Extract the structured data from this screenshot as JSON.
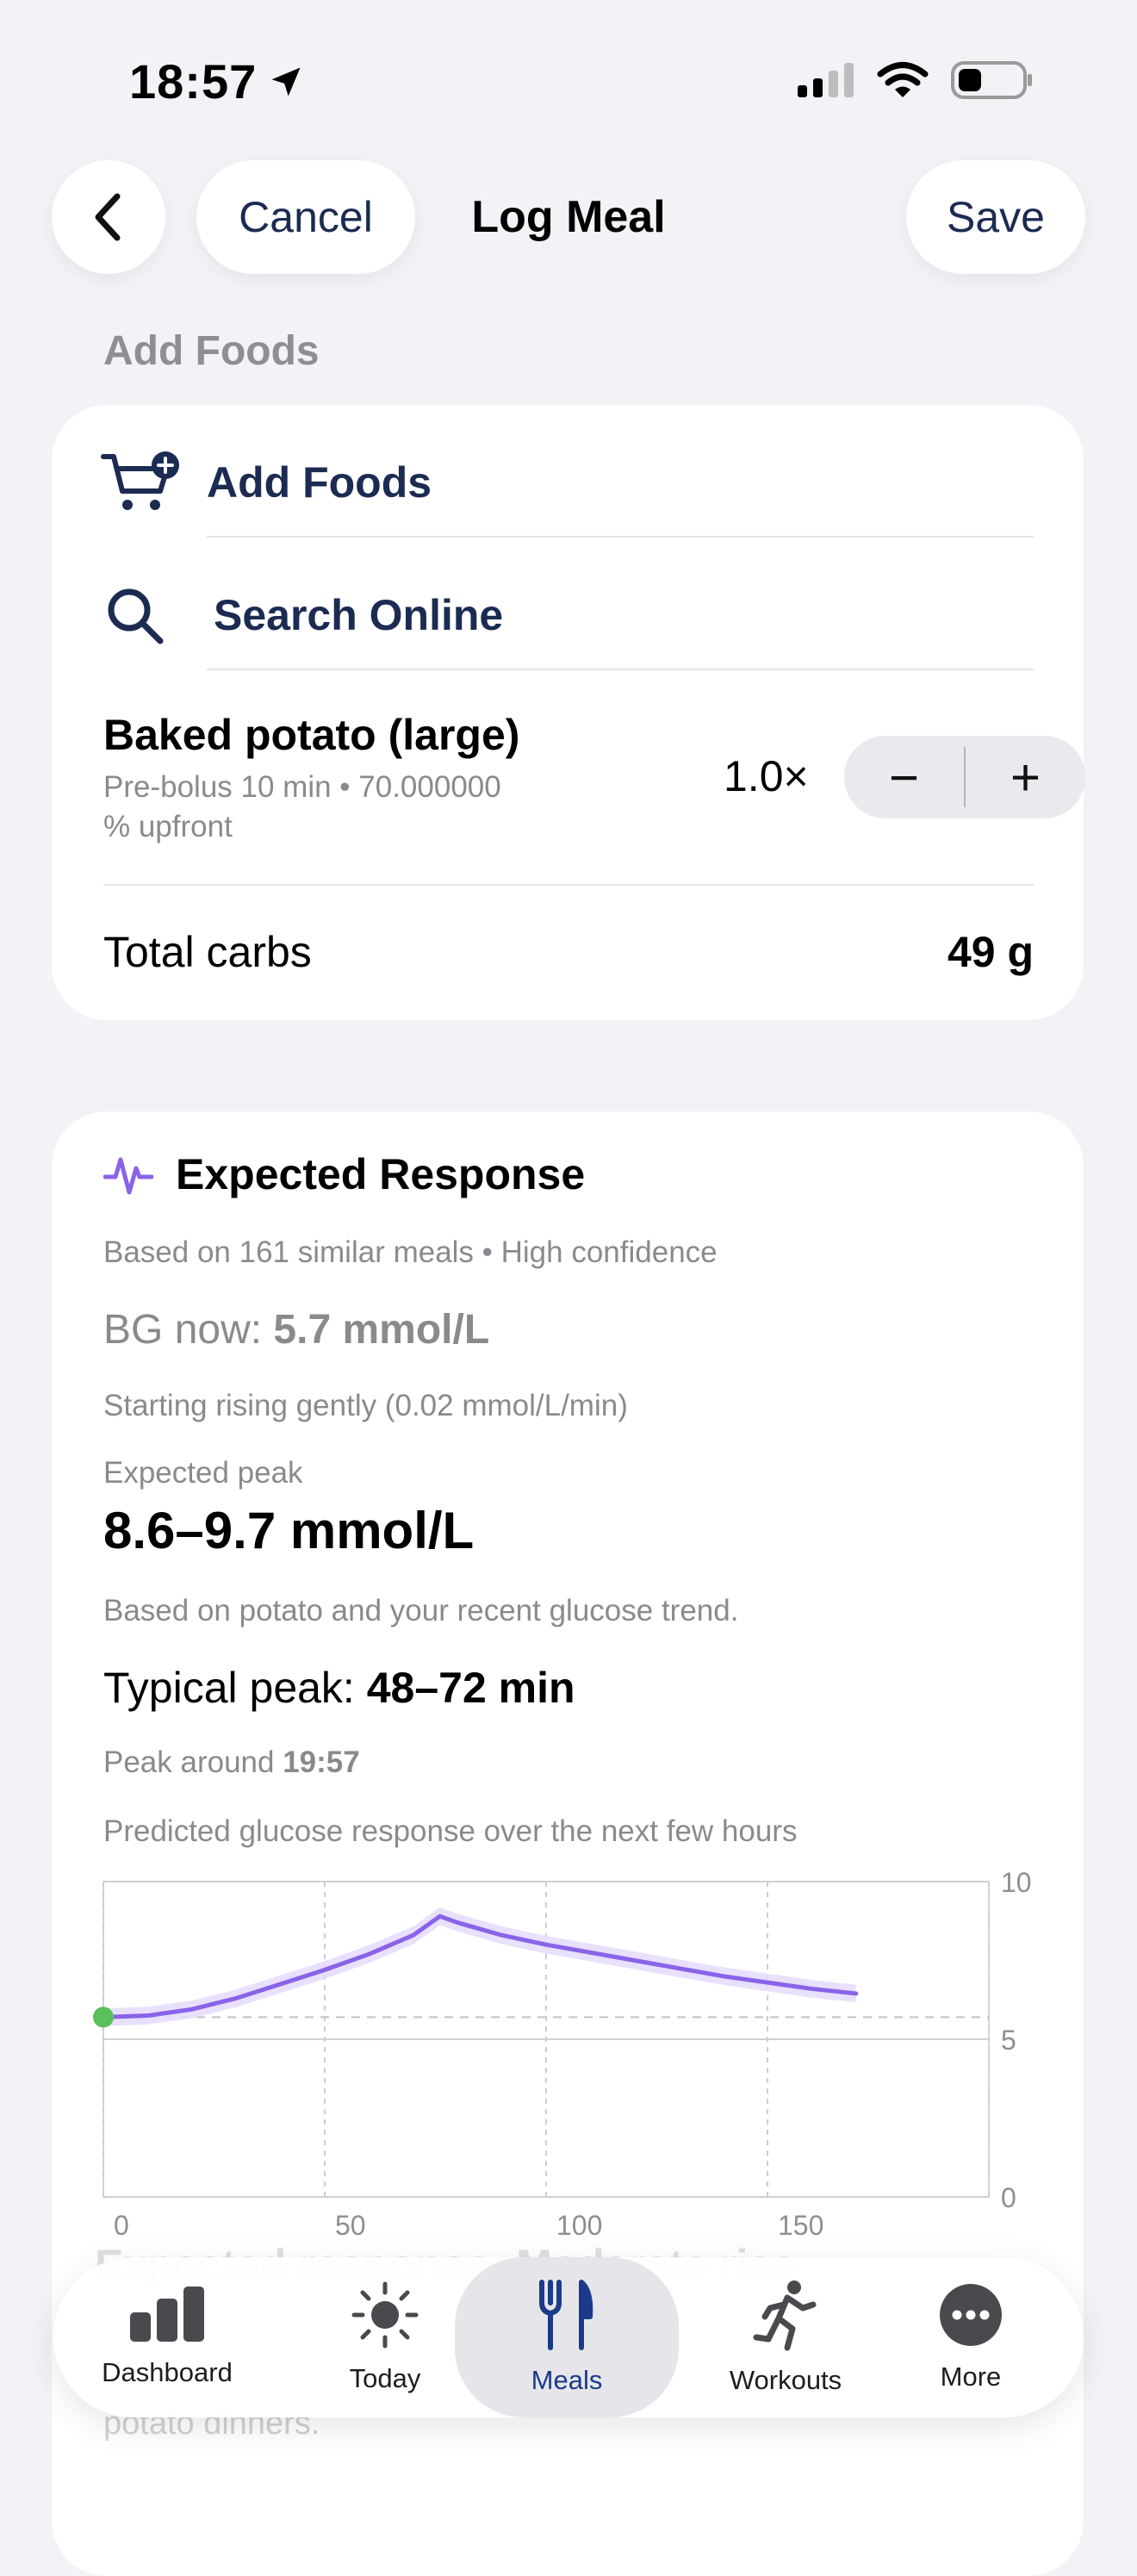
{
  "status_bar": {
    "time": "18:57"
  },
  "nav": {
    "back_icon": "chevron-left-icon",
    "cancel_label": "Cancel",
    "title": "Log Meal",
    "save_label": "Save"
  },
  "section_header": "Add Foods",
  "add_card": {
    "add_foods_label": "Add Foods",
    "add_foods_icon": "cart-plus-icon",
    "search_online_label": "Search Online",
    "search_icon": "magnifier-icon",
    "food": {
      "name": "Baked potato (large)",
      "detail_line1": "Pre-bolus 10 min • 70.000000",
      "detail_line2": "% upfront",
      "multiplier": "1.0×",
      "decrement": "−",
      "increment": "+"
    },
    "total_label": "Total carbs",
    "total_value": "49 g"
  },
  "response_card": {
    "title": "Expected Response",
    "icon": "waveform-icon",
    "based_on": "Based on 161 similar meals • High confidence",
    "bg_now_label": "BG now:",
    "bg_now_value": "5.7 mmol/L",
    "trend": "Starting rising gently (0.02 mmol/L/min)",
    "expected_peak_label": "Expected peak",
    "expected_peak_value": "8.6–9.7 mmol/L",
    "peak_basis": "Based on potato and your recent glucose trend.",
    "typical_peak_label": "Typical peak:",
    "typical_peak_value": "48–72 min",
    "peak_around_label": "Peak around",
    "peak_around_value": "19:57",
    "chart_caption": "Predicted glucose response over the next few hours"
  },
  "chart_data": {
    "type": "line",
    "x_ticks": [
      "0",
      "50",
      "100",
      "150"
    ],
    "y_ticks": [
      "10",
      "5",
      "0"
    ],
    "xlim": [
      0,
      200
    ],
    "ylim": [
      0,
      10
    ],
    "grid": true,
    "current_point": {
      "x": 0,
      "y": 5.7
    },
    "baseline": 5.7,
    "series": [
      {
        "x": [
          0,
          10,
          20,
          30,
          40,
          50,
          60,
          70,
          76,
          80,
          90,
          100,
          110,
          120,
          130,
          140,
          150,
          160,
          170
        ],
        "y": [
          5.7,
          5.75,
          5.95,
          6.3,
          6.75,
          7.2,
          7.7,
          8.3,
          8.9,
          8.7,
          8.3,
          8.0,
          7.75,
          7.5,
          7.25,
          7.0,
          6.8,
          6.6,
          6.45
        ]
      }
    ],
    "band_halfwidth": 0.28,
    "colors": {
      "line": "#8a63e8",
      "band": "#e4dafb",
      "current": "#5ac05a"
    }
  },
  "peek_overlay": {
    "line1": "Expected response: Moderate rise",
    "line2": "potato dinners."
  },
  "tabbar": {
    "tabs": [
      {
        "label": "Dashboard",
        "icon": "bar-chart-icon"
      },
      {
        "label": "Today",
        "icon": "sun-icon"
      },
      {
        "label": "Meals",
        "icon": "fork-knife-icon"
      },
      {
        "label": "Workouts",
        "icon": "runner-icon"
      },
      {
        "label": "More",
        "icon": "ellipsis-circle-icon"
      }
    ]
  }
}
